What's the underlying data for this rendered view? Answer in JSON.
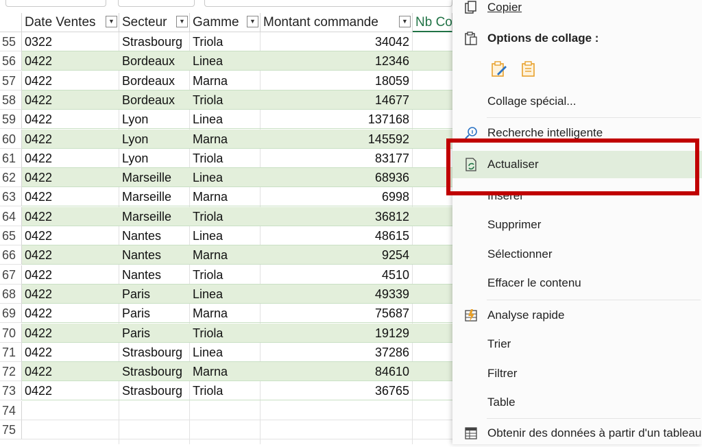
{
  "columns": [
    {
      "label": "Date Ventes"
    },
    {
      "label": "Secteur"
    },
    {
      "label": "Gamme"
    },
    {
      "label": "Montant commande"
    },
    {
      "label": "Nb Co"
    }
  ],
  "rows": [
    {
      "num": "55",
      "date": "0322",
      "secteur": "Strasbourg",
      "gamme": "Triola",
      "montant": "34042"
    },
    {
      "num": "56",
      "date": "0422",
      "secteur": "Bordeaux",
      "gamme": "Linea",
      "montant": "12346"
    },
    {
      "num": "57",
      "date": "0422",
      "secteur": "Bordeaux",
      "gamme": "Marna",
      "montant": "18059"
    },
    {
      "num": "58",
      "date": "0422",
      "secteur": "Bordeaux",
      "gamme": "Triola",
      "montant": "14677"
    },
    {
      "num": "59",
      "date": "0422",
      "secteur": "Lyon",
      "gamme": "Linea",
      "montant": "137168"
    },
    {
      "num": "60",
      "date": "0422",
      "secteur": "Lyon",
      "gamme": "Marna",
      "montant": "145592"
    },
    {
      "num": "61",
      "date": "0422",
      "secteur": "Lyon",
      "gamme": "Triola",
      "montant": "83177"
    },
    {
      "num": "62",
      "date": "0422",
      "secteur": "Marseille",
      "gamme": "Linea",
      "montant": "68936"
    },
    {
      "num": "63",
      "date": "0422",
      "secteur": "Marseille",
      "gamme": "Marna",
      "montant": "6998"
    },
    {
      "num": "64",
      "date": "0422",
      "secteur": "Marseille",
      "gamme": "Triola",
      "montant": "36812"
    },
    {
      "num": "65",
      "date": "0422",
      "secteur": "Nantes",
      "gamme": "Linea",
      "montant": "48615"
    },
    {
      "num": "66",
      "date": "0422",
      "secteur": "Nantes",
      "gamme": "Marna",
      "montant": "9254"
    },
    {
      "num": "67",
      "date": "0422",
      "secteur": "Nantes",
      "gamme": "Triola",
      "montant": "4510"
    },
    {
      "num": "68",
      "date": "0422",
      "secteur": "Paris",
      "gamme": "Linea",
      "montant": "49339"
    },
    {
      "num": "69",
      "date": "0422",
      "secteur": "Paris",
      "gamme": "Marna",
      "montant": "75687"
    },
    {
      "num": "70",
      "date": "0422",
      "secteur": "Paris",
      "gamme": "Triola",
      "montant": "19129"
    },
    {
      "num": "71",
      "date": "0422",
      "secteur": "Strasbourg",
      "gamme": "Linea",
      "montant": "37286"
    },
    {
      "num": "72",
      "date": "0422",
      "secteur": "Strasbourg",
      "gamme": "Marna",
      "montant": "84610"
    },
    {
      "num": "73",
      "date": "0422",
      "secteur": "Strasbourg",
      "gamme": "Triola",
      "montant": "36765"
    }
  ],
  "empty_rows": [
    "74",
    "75"
  ],
  "context_menu": {
    "copy": "Copier",
    "paste_options": "Options de collage :",
    "paste_special": "Collage spécial...",
    "smart_lookup": "Recherche intelligente",
    "refresh": "Actualiser",
    "insert": "Insérer",
    "delete": "Supprimer",
    "select": "Sélectionner",
    "clear_contents": "Effacer le contenu",
    "quick_analysis": "Analyse rapide",
    "sort": "Trier",
    "filter": "Filtrer",
    "table": "Table",
    "get_data": "Obtenir des données à partir d'un tableau"
  },
  "colors": {
    "band_green": "#e3efdb",
    "highlight": "#e1eddc",
    "red_box": "#c00000",
    "header_green_text": "#217346",
    "paste_icon_orange": "#e8a02a"
  }
}
